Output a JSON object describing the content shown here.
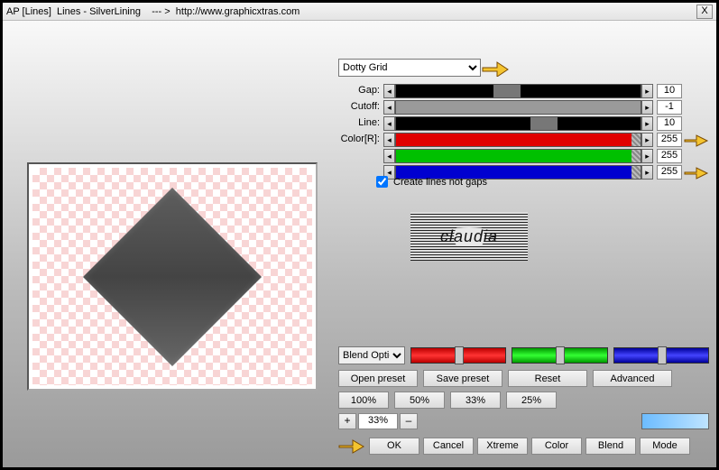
{
  "window": {
    "title": "AP [Lines]  Lines - SilverLining    --- >  http://www.graphicxtras.com",
    "close": "X"
  },
  "preset": {
    "selected": "Dotty Grid"
  },
  "sliders": {
    "gap": {
      "label": "Gap:",
      "value": "10"
    },
    "cutoff": {
      "label": "Cutoff:",
      "value": "-1"
    },
    "line": {
      "label": "Line:",
      "value": "10"
    },
    "colorR": {
      "label": "Color[R]:",
      "value": "255"
    },
    "colorG": {
      "label": "",
      "value": "255"
    },
    "colorB": {
      "label": "",
      "value": "255"
    }
  },
  "checkbox": {
    "label": "Create lines not gaps",
    "checked": true
  },
  "logo_text": "claudia",
  "blend_option": "Blend Optio",
  "preset_buttons": {
    "open": "Open preset",
    "save": "Save preset",
    "reset": "Reset",
    "advanced": "Advanced"
  },
  "zoom_levels": {
    "p100": "100%",
    "p50": "50%",
    "p33": "33%",
    "p25": "25%"
  },
  "zoom": {
    "minus_left": "+",
    "value": "33%",
    "minus_right": "–"
  },
  "actions": {
    "ok": "OK",
    "cancel": "Cancel",
    "xtreme": "Xtreme",
    "color": "Color",
    "blend": "Blend",
    "mode": "Mode"
  },
  "colors": {
    "swatch": "#7fc6ff"
  }
}
